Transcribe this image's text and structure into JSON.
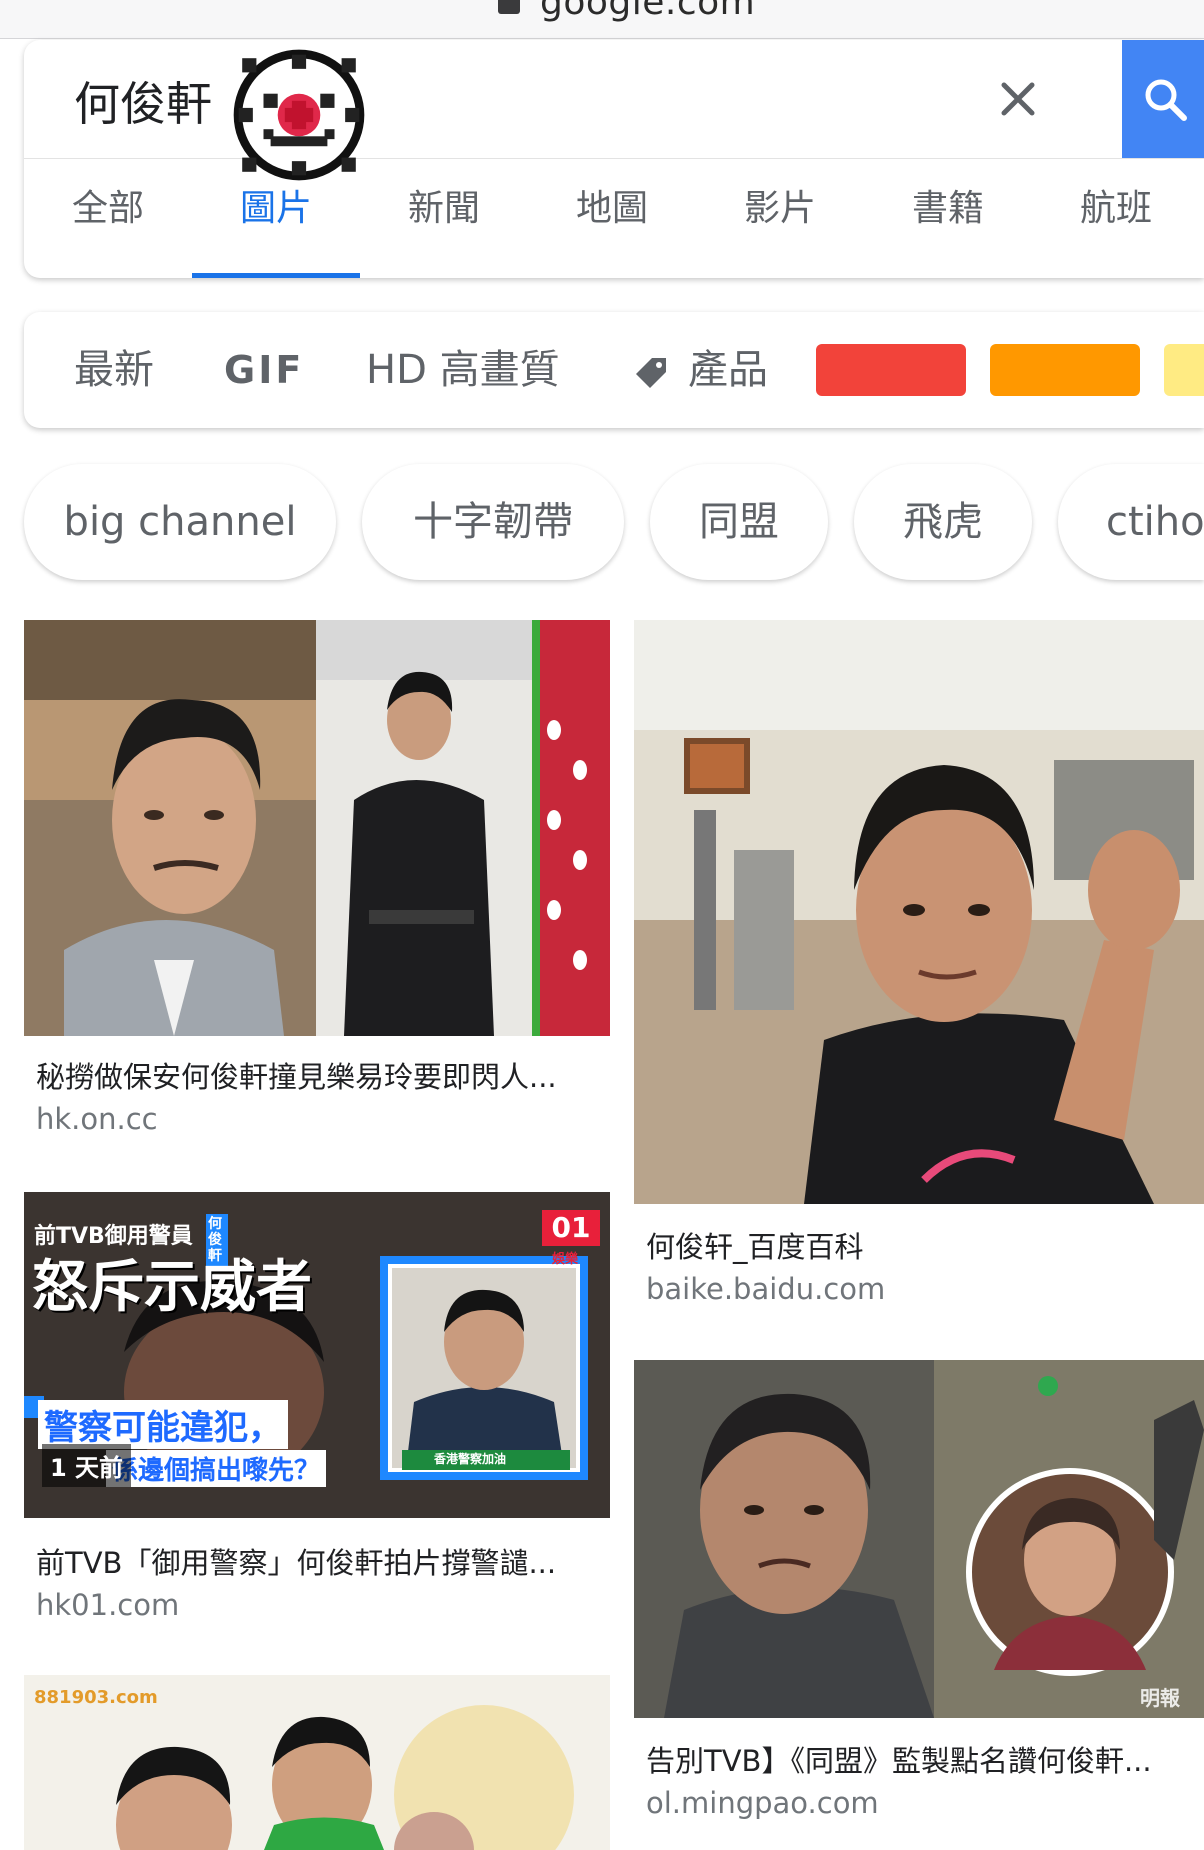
{
  "browser": {
    "url": "google.com"
  },
  "search": {
    "query": "何俊軒",
    "clear_icon": "close-icon",
    "search_icon": "search-icon",
    "accent": "#4285f4"
  },
  "tabs": [
    {
      "label": "全部",
      "active": false
    },
    {
      "label": "圖片",
      "active": true
    },
    {
      "label": "新聞",
      "active": false
    },
    {
      "label": "地圖",
      "active": false
    },
    {
      "label": "影片",
      "active": false
    },
    {
      "label": "書籍",
      "active": false
    },
    {
      "label": "航班",
      "active": false
    }
  ],
  "filters": {
    "latest": "最新",
    "gif": "GIF",
    "hd": "HD 高畫質",
    "products": "產品",
    "colors": [
      "#f2433a",
      "#ff9800",
      "#ffeb83"
    ]
  },
  "chips": [
    "big channel",
    "十字韌帶",
    "同盟",
    "飛虎",
    "ctiho"
  ],
  "results": [
    {
      "title": "秘撈做保安何俊軒撞見樂易玲要即閃人...",
      "source": "hk.on.cc"
    },
    {
      "title": "何俊轩_百度百科",
      "source": "baike.baidu.com"
    },
    {
      "title": "前TVB「御用警察」何俊軒拍片撐警譴...",
      "source": "hk01.com",
      "overlay": {
        "kicker": "前TVB御用警員",
        "name": "何俊軒",
        "headline": "怒斥示威者",
        "quote": "警察可能違犯，",
        "quote2": "係邊個搞出嚟先？",
        "time": "1 天前",
        "brand": "01",
        "brand_sub": "娛樂",
        "caption": "香港警察加油"
      }
    },
    {
      "title": "告別TVB】《同盟》監製點名讚何俊軒...",
      "source": "ol.mingpao.com",
      "watermark": "明報"
    },
    {
      "title": "",
      "source": "",
      "logo": "881903.com"
    }
  ]
}
